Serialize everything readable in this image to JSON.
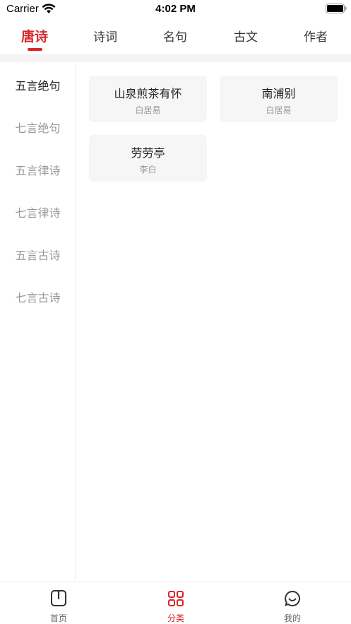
{
  "status_bar": {
    "carrier": "Carrier",
    "time": "4:02 PM"
  },
  "top_tabs": [
    {
      "label": "唐诗",
      "active": true
    },
    {
      "label": "诗词",
      "active": false
    },
    {
      "label": "名句",
      "active": false
    },
    {
      "label": "古文",
      "active": false
    },
    {
      "label": "作者",
      "active": false
    }
  ],
  "categories": [
    {
      "label": "五言绝句",
      "active": true
    },
    {
      "label": "七言绝句",
      "active": false
    },
    {
      "label": "五言律诗",
      "active": false
    },
    {
      "label": "七言律诗",
      "active": false
    },
    {
      "label": "五言古诗",
      "active": false
    },
    {
      "label": "七言古诗",
      "active": false
    }
  ],
  "poems": [
    {
      "title": "山泉煎茶有怀",
      "author": "白居易"
    },
    {
      "title": "南浦别",
      "author": "白居易"
    },
    {
      "title": "劳劳亭",
      "author": "李白"
    }
  ],
  "bottom_nav": [
    {
      "label": "首页",
      "icon": "book-icon",
      "active": false
    },
    {
      "label": "分类",
      "icon": "grid-icon",
      "active": true
    },
    {
      "label": "我的",
      "icon": "chat-smile-icon",
      "active": false
    }
  ],
  "colors": {
    "accent": "#d9262b",
    "inactive_text": "#999999",
    "card_bg": "#f6f6f6"
  }
}
